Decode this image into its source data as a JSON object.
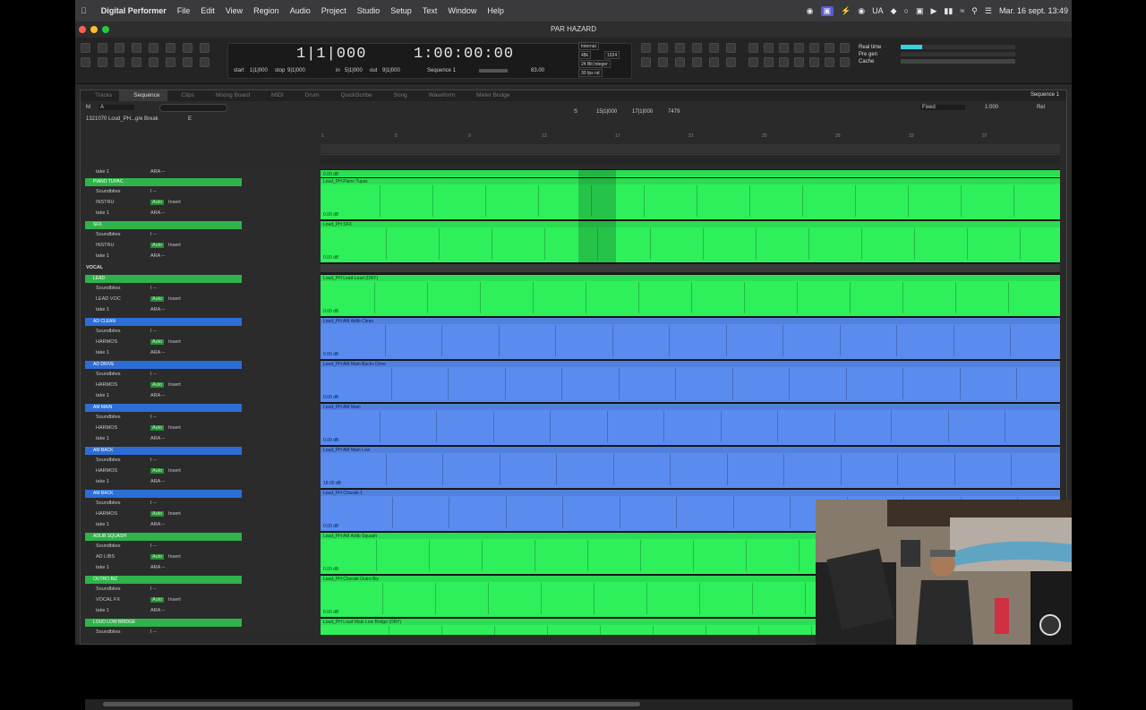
{
  "menubar": {
    "app": "Digital Performer",
    "items": [
      "File",
      "Edit",
      "View",
      "Region",
      "Audio",
      "Project",
      "Studio",
      "Setup",
      "Text",
      "Window",
      "Help"
    ],
    "status": [
      "UA"
    ],
    "datetime": "Mar. 16 sept. 13:49"
  },
  "window": {
    "title": "PAR HAZARD"
  },
  "transport": {
    "counter": "1|1|000",
    "time": "1:00:00:00",
    "start_label": "start",
    "start": "1|1|000",
    "stop_label": "stop",
    "stop": "9|1|000",
    "in_label": "in",
    "in": "5|1|000",
    "out_label": "out",
    "out": "9|1|000",
    "sequence": "Sequence 1",
    "tempo": "83.00",
    "sync": "Internal",
    "rate": "48k",
    "buffer": "1024",
    "bits": "24 Bit Integer",
    "fps": "30 fps nd",
    "rt_labels": [
      "Real time",
      "Pre gen",
      "Cache"
    ]
  },
  "tabs": [
    "Tracks",
    "Sequence",
    "Clips",
    "Mixing Board",
    "MIDI",
    "Drum",
    "QuickScribe",
    "Song",
    "Waveform",
    "Meter Bridge"
  ],
  "seq_menu": "Sequence 1",
  "ctrl": {
    "m": "M",
    "a": "A",
    "region": "1321070 Loud_PH...g/e Break",
    "e": "E",
    "s": "S",
    "pos1": "15|1|000",
    "pos2": "17|1|000",
    "len": "7479",
    "fixed": "Fixed",
    "zoom": "1:000",
    "rel": "Rel"
  },
  "ruler": {
    "bars": [
      "1",
      "5",
      "9",
      "13",
      "17",
      "21",
      "25",
      "29",
      "33",
      "37"
    ]
  },
  "tracks": [
    {
      "name": "",
      "color": "green",
      "input": "",
      "take": "take 1",
      "lane_label": "",
      "db": "0.00 dB",
      "partial": true
    },
    {
      "name": "PIANO TUPAC",
      "color": "green",
      "input": "INSTRU",
      "take": "take 1",
      "lane_label": "Loud_PH Piano Tupac",
      "db": "0.00 dB"
    },
    {
      "name": "SFX",
      "color": "green",
      "input": "INSTRU",
      "take": "take 1",
      "lane_label": "Loud_PH SFX",
      "db": "0.00 dB"
    },
    {
      "name": "LEAD",
      "color": "green",
      "input": "LEAD VOC",
      "take": "take 1",
      "lane_label": "Loud_PH Lead Lead (DRY)",
      "db": "0.00 dB"
    },
    {
      "name": "AD CLEAN",
      "color": "blue",
      "input": "HARMOS",
      "take": "take 1",
      "lane_label": "Loud_PH AM Adlib Clean",
      "db": "0.00 dB"
    },
    {
      "name": "AD DRIVE",
      "color": "blue",
      "input": "HARMOS",
      "take": "take 1",
      "lane_label": "Loud_PH AM Main Backs Drive",
      "db": "0.00 dB"
    },
    {
      "name": "AM MAIN",
      "color": "blue",
      "input": "HARMOS",
      "take": "take 1",
      "lane_label": "Loud_PH AM Main",
      "db": "0.00 dB"
    },
    {
      "name": "AM BACK",
      "color": "blue",
      "input": "HARMOS",
      "take": "take 1",
      "lane_label": "Loud_PH AM Main Low",
      "db": "18.00 dB"
    },
    {
      "name": "AM BACK",
      "color": "blue",
      "input": "HARMOS",
      "take": "take 1",
      "lane_label": "Loud_PH Chorale 1",
      "db": "0.00 dB"
    },
    {
      "name": "ADLIB SQUASH",
      "color": "green",
      "input": "AD LIBS",
      "take": "take 1",
      "lane_label": "Loud_PH AM Adlib Squash",
      "db": "0.00 dB"
    },
    {
      "name": "OUTRO BIZ",
      "color": "green",
      "input": "VOCAL FX",
      "take": "take 1",
      "lane_label": "Loud_PH Chorale Outro Biz",
      "db": "0.00 dB"
    },
    {
      "name": "LOUD LOW BRIDGE",
      "color": "green",
      "input": "",
      "take": "",
      "lane_label": "Loud_PH Loud Main Low Bridge (DRY)",
      "db": ""
    }
  ],
  "folder": "VOCAL",
  "row_labels": {
    "soundbites": "Soundbites",
    "auto": "Auto",
    "insert": "Insert",
    "ara": "ARA --",
    "dash": "I --"
  }
}
